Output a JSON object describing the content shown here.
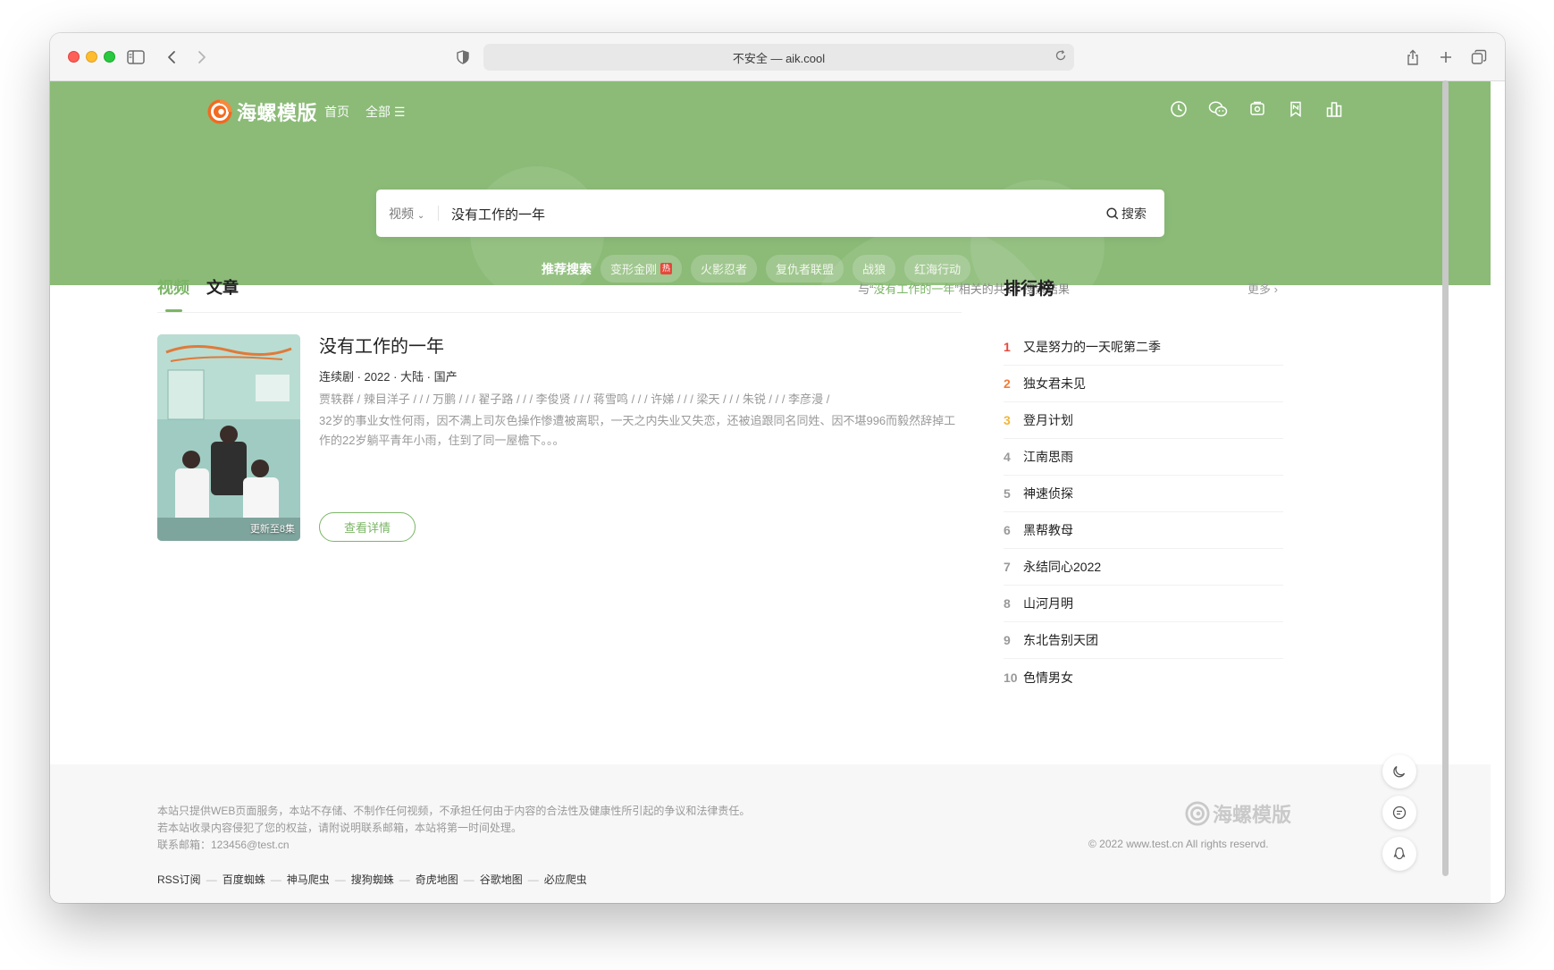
{
  "browser": {
    "address": "不安全 — aik.cool"
  },
  "site": {
    "logo_text": "海螺模版",
    "nav": [
      {
        "label": "首页"
      },
      {
        "label": "全部 ☰"
      }
    ]
  },
  "search": {
    "category": "视频",
    "value": "没有工作的一年",
    "button": "搜索",
    "suggest_label": "推荐搜索",
    "suggestions": [
      {
        "label": "变形金刚",
        "hot": "热"
      },
      {
        "label": "火影忍者"
      },
      {
        "label": "复仇者联盟"
      },
      {
        "label": "战狼"
      },
      {
        "label": "红海行动"
      }
    ]
  },
  "results": {
    "tabs": [
      {
        "label": "视频"
      },
      {
        "label": "文章"
      }
    ],
    "count_prefix": "与“",
    "count_keyword": "没有工作的一年",
    "count_suffix": "”相关的共1个搜索结果",
    "item": {
      "title": "没有工作的一年",
      "poster_badge": "更新至8集",
      "meta": "连续剧 · 2022 · 大陆 · 国产",
      "cast": "贾轶群 / 辣目洋子 / / / 万鹏 / / / 翟子路 / / / 李俊贤 / / / 蒋雪鸣 / / / 许娣 / / / 梁天 / / / 朱锐 / / / 李彦漫 /",
      "desc": "32岁的事业女性何雨，因不满上司灰色操作惨遭被离职，一天之内失业又失恋，还被追跟同名同姓、因不堪996而毅然辞掉工作的22岁躺平青年小雨，住到了同一屋檐下。。。",
      "detail_button": "查看详情"
    }
  },
  "ranking": {
    "title": "排行榜",
    "more": "更多 ›",
    "items": [
      {
        "num": "1",
        "name": "又是努力的一天呢第二季",
        "color": "#e8473c"
      },
      {
        "num": "2",
        "name": "独女君未见",
        "color": "#f07d3a"
      },
      {
        "num": "3",
        "name": "登月计划",
        "color": "#f1b53a"
      },
      {
        "num": "4",
        "name": "江南思雨",
        "color": "#999999"
      },
      {
        "num": "5",
        "name": "神速侦探",
        "color": "#999999"
      },
      {
        "num": "6",
        "name": "黑帮教母",
        "color": "#999999"
      },
      {
        "num": "7",
        "name": "永结同心2022",
        "color": "#999999"
      },
      {
        "num": "8",
        "name": "山河月明",
        "color": "#999999"
      },
      {
        "num": "9",
        "name": "东北告别天团",
        "color": "#999999"
      },
      {
        "num": "10",
        "name": "色情男女",
        "color": "#999999"
      }
    ]
  },
  "footer": {
    "lines": [
      "本站只提供WEB页面服务，本站不存储、不制作任何视频，不承担任何由于内容的合法性及健康性所引起的争议和法律责任。",
      "若本站收录内容侵犯了您的权益，请附说明联系邮箱，本站将第一时间处理。",
      "联系邮箱：123456@test.cn"
    ],
    "links": [
      "RSS订阅",
      "百度蜘蛛",
      "神马爬虫",
      "搜狗蜘蛛",
      "奇虎地图",
      "谷歌地图",
      "必应爬虫"
    ],
    "logo_text": "海螺模版",
    "copyright": "© 2022 www.test.cn All rights reservd."
  },
  "colors": {
    "accent": "#7bb566",
    "hero_bg": "#8bbb77"
  }
}
